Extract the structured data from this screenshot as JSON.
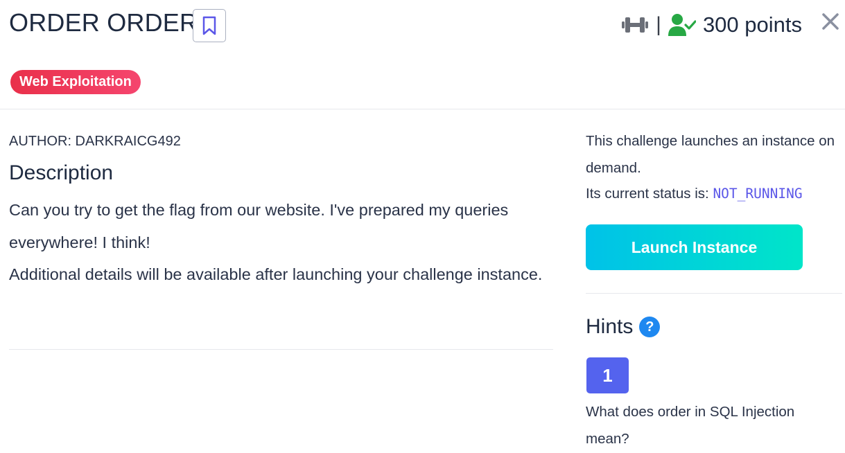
{
  "challenge": {
    "title": "ORDER ORDER",
    "difficulty_icon": "dumbbell-icon",
    "separator": "|",
    "solved_icon": "user-check-icon",
    "points_label": "300 points",
    "category_tag": "Web Exploitation"
  },
  "description": {
    "author": "AUTHOR: DARKRAICG492",
    "heading": "Description",
    "paragraph_1": "Can you try to get the flag from our website. I've prepared my queries everywhere! I think!",
    "paragraph_2": "Additional details will be available after launching your challenge instance."
  },
  "instance": {
    "info": "This challenge launches an instance on demand.",
    "status_prefix": "Its current status is:",
    "status_value": "NOT_RUNNING",
    "launch_label": "Launch Instance"
  },
  "hints": {
    "heading": "Hints",
    "help_icon_label": "?",
    "items": [
      {
        "number": "1",
        "text": "What does order in SQL Injection mean?"
      }
    ]
  },
  "colors": {
    "accent": "#5463ee",
    "tag": "#f0354f",
    "launch_start": "#00c2e8",
    "launch_end": "#00e5c9",
    "status": "#5b57e8",
    "solved": "#27a844"
  }
}
